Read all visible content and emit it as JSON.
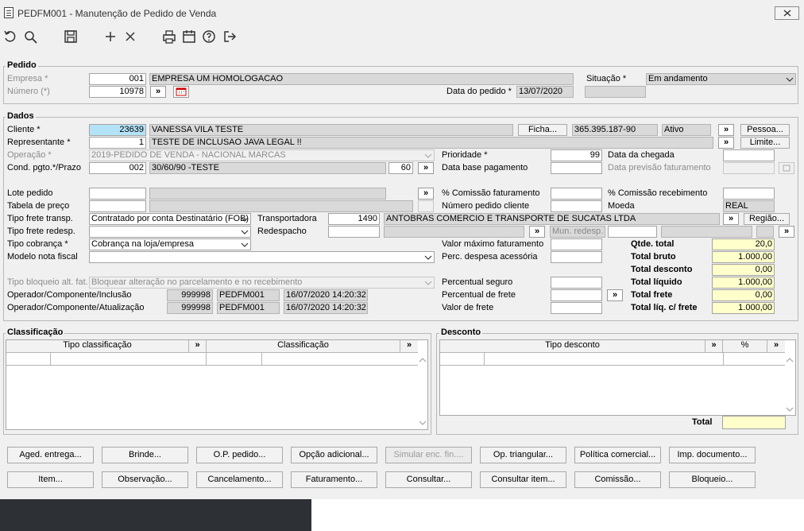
{
  "window": {
    "title": "PEDFM001 - Manutenção de Pedido de Venda"
  },
  "toolbar": {
    "icons": [
      "undo-icon",
      "search-icon",
      "save-icon",
      "add-icon",
      "delete-icon",
      "print-icon",
      "calendar-icon",
      "help-icon",
      "exit-icon"
    ]
  },
  "pedido": {
    "title": "Pedido",
    "empresa_label": "Empresa *",
    "empresa_code": "001",
    "empresa_name": "EMPRESA UM  HOMOLOGACAO",
    "numero_label": "Número (*)",
    "numero_value": "10978",
    "situacao_label": "Situação *",
    "situacao_value": "Em andamento",
    "data_label": "Data do pedido *",
    "data_value": "13/07/2020"
  },
  "dados": {
    "title": "Dados",
    "cliente_label": "Cliente *",
    "cliente_code": "23639",
    "cliente_name": "VANESSA VILA   TESTE",
    "ficha_label": "Ficha...",
    "cliente_doc": "365.395.187-90",
    "cliente_status": "Ativo",
    "pessoa_label": "Pessoa...",
    "representante_label": "Representante *",
    "representante_code": "1",
    "representante_name": "TESTE DE INCLUSAO JAVA LEGAL !!",
    "limite_label": "Limite...",
    "operacao_label": "Operação *",
    "operacao_value": "2019-PEDIDO DE VENDA - NACIONAL MARCAS",
    "prioridade_label": "Prioridade *",
    "prioridade_value": "99",
    "data_chegada_label": "Data da chegada",
    "cond_label": "Cond. pgto.*/Prazo",
    "cond_code": "002",
    "cond_name": "30/60/90 -TESTE",
    "prazo_value": "60",
    "data_base_label": "Data base pagamento",
    "data_prev_label": "Data previsão faturamento",
    "lote_label": "Lote pedido",
    "comissao_fat_label": "% Comissão faturamento",
    "comissao_rec_label": "% Comissão recebimento",
    "tabela_label": "Tabela de preço",
    "num_pedido_cliente_label": "Número pedido cliente",
    "moeda_label": "Moeda",
    "moeda_value": "REAL",
    "frete_transp_label": "Tipo frete transp.",
    "frete_transp_value": "Contratado por conta Destinatário (FOB)",
    "transportadora_label": "Transportadora",
    "transportadora_code": "1490",
    "transportadora_name": "ANTOBRAS COMERCIO E TRANSPORTE DE SUCATAS LTDA",
    "regiao_label": "Região...",
    "frete_redesp_label": "Tipo frete redesp.",
    "redespacho_label": "Redespacho",
    "mun_redesp_label": "Mun. redesp.",
    "cobranca_label": "Tipo cobrança *",
    "cobranca_value": "Cobrança na loja/empresa",
    "valor_max_label": "Valor máximo faturamento",
    "modelo_nf_label": "Modelo nota fiscal",
    "perc_despesa_label": "Perc. despesa acessória",
    "bloqueio_label": "Tipo bloqueio alt. fat.",
    "bloqueio_value": "Bloquear alteração no parcelamento e no recebimento",
    "perc_seguro_label": "Percentual seguro",
    "perc_frete_label": "Percentual de frete",
    "valor_frete_label": "Valor de frete",
    "op_inclusao_label": "Operador/Componente/Inclusão",
    "op_inclusao_code": "999998",
    "op_inclusao_comp": "PEDFM001",
    "op_inclusao_date": "16/07/2020 14:20:32",
    "op_atual_label": "Operador/Componente/Atualização",
    "op_atual_code": "999998",
    "op_atual_comp": "PEDFM001",
    "op_atual_date": "16/07/2020 14:20:32",
    "totals": [
      {
        "label": "Qtde. total",
        "value": "20,0"
      },
      {
        "label": "Total bruto",
        "value": "1.000,00"
      },
      {
        "label": "Total desconto",
        "value": "0,00"
      },
      {
        "label": "Total líquido",
        "value": "1.000,00"
      },
      {
        "label": "Total frete",
        "value": "0,00"
      },
      {
        "label": "Total líq. c/ frete",
        "value": "1.000,00"
      }
    ]
  },
  "classificacao": {
    "title": "Classificação",
    "col1": "Tipo classificação",
    "col2": "Classificação"
  },
  "desconto": {
    "title": "Desconto",
    "col1": "Tipo desconto",
    "col2": "%",
    "total_label": "Total"
  },
  "buttons_row1": [
    "Aged. entrega...",
    "Brinde...",
    "O.P. pedido...",
    "Opção adicional...",
    "Simular enc. fin....",
    "Op. triangular...",
    "Política comercial...",
    "Imp. documento..."
  ],
  "buttons_row2": [
    "Item...",
    "Observação...",
    "Cancelamento...",
    "Faturamento...",
    "Consultar...",
    "Consultar item...",
    "Comissão...",
    "Bloqueio..."
  ],
  "more_symbol": "»"
}
